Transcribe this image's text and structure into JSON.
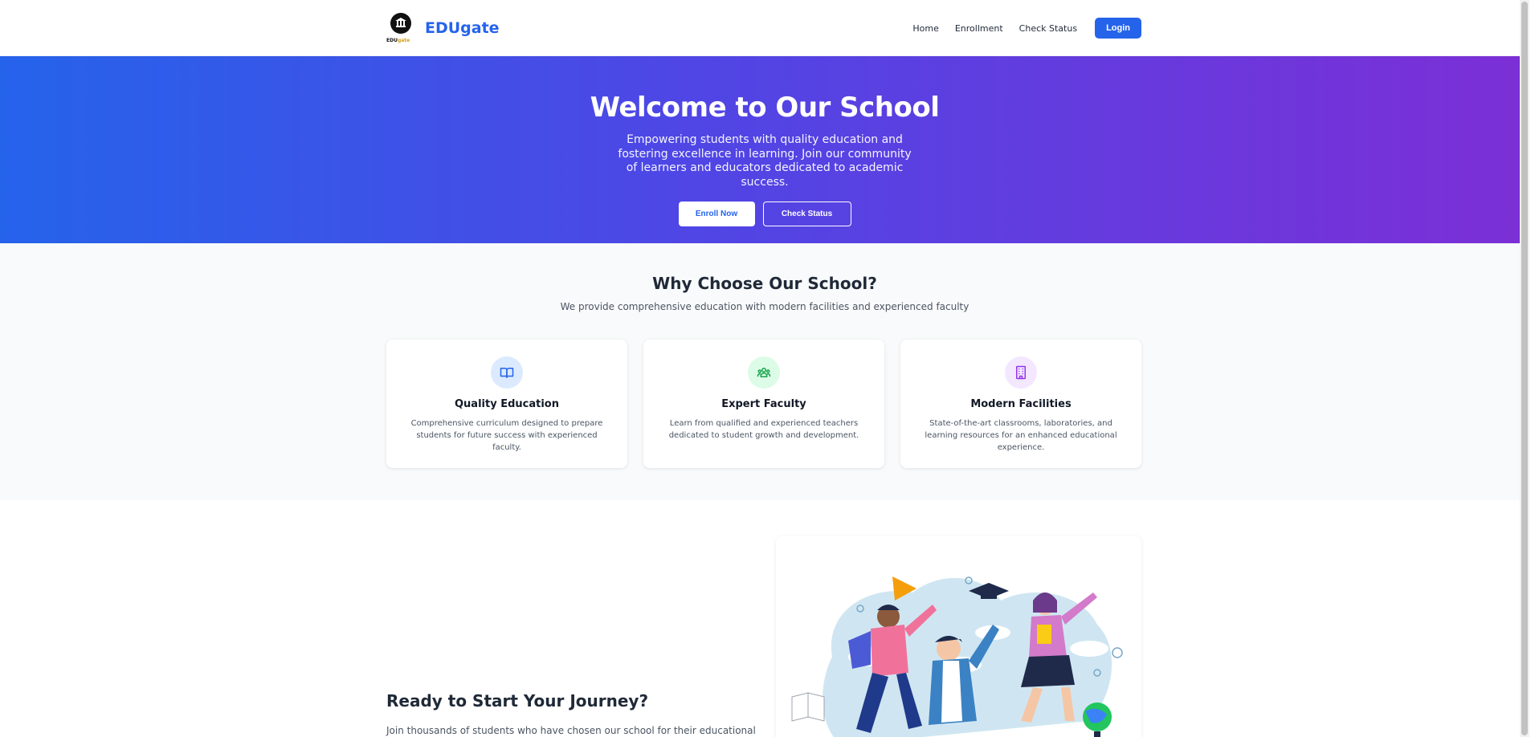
{
  "nav": {
    "brand": "EDUgate",
    "logo_text_main": "EDU",
    "logo_text_accent": "gate",
    "links": [
      "Home",
      "Enrollment",
      "Check Status"
    ],
    "login": "Login"
  },
  "hero": {
    "title": "Welcome to Our School",
    "subtitle": "Empowering students with quality education and fostering excellence in learning. Join our community of learners and educators dedicated to academic success.",
    "enroll_button": "Enroll Now",
    "status_button": "Check Status"
  },
  "features": {
    "title": "Why Choose Our School?",
    "subtitle": "We provide comprehensive education with modern facilities and experienced faculty",
    "cards": [
      {
        "icon": "book-icon",
        "title": "Quality Education",
        "text": "Comprehensive curriculum designed to prepare students for future success with experienced faculty."
      },
      {
        "icon": "users-icon",
        "title": "Expert Faculty",
        "text": "Learn from qualified and experienced teachers dedicated to student growth and development."
      },
      {
        "icon": "building-icon",
        "title": "Modern Facilities",
        "text": "State-of-the-art classrooms, laboratories, and learning resources for an enhanced educational experience."
      }
    ]
  },
  "cta": {
    "title": "Ready to Start Your Journey?",
    "text": "Join thousands of students who have chosen our school for their educational"
  },
  "colors": {
    "primary": "#2563eb",
    "hero_start": "#2563eb",
    "hero_end": "#7c2fd6",
    "features_bg": "#f9fafb"
  }
}
